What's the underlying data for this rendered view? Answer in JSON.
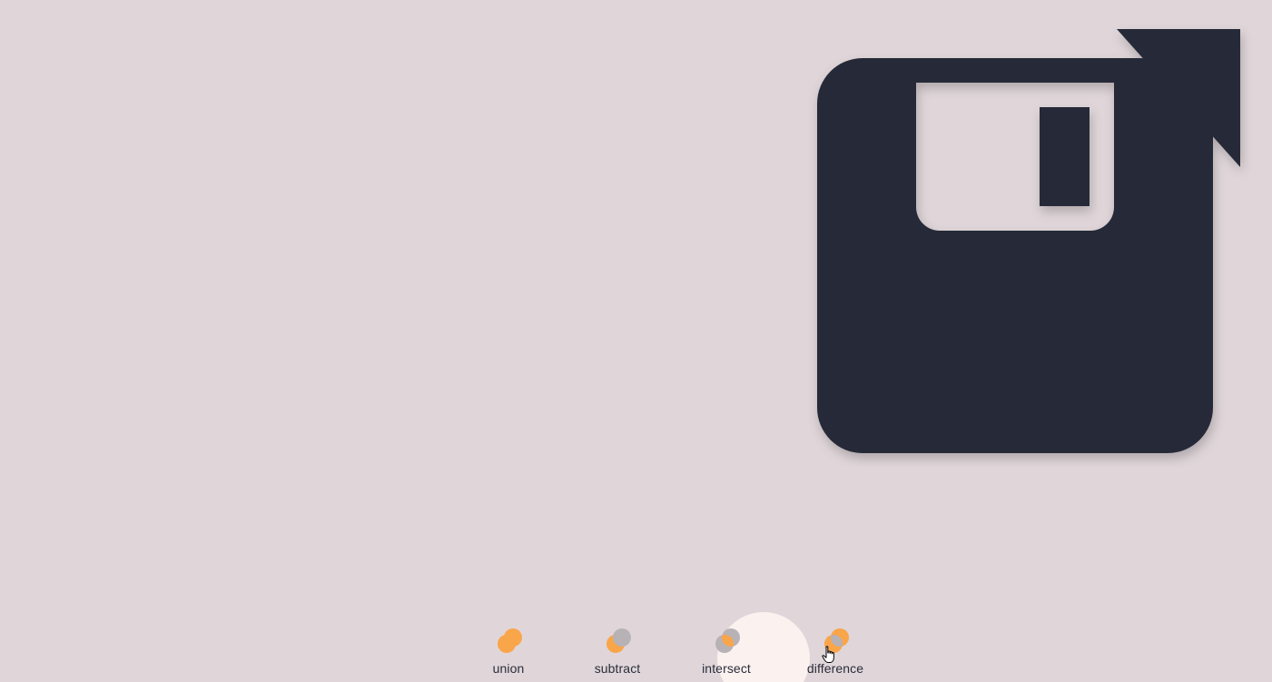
{
  "colors": {
    "background": "#e0d6da",
    "shape_fill": "#282c39",
    "accent": "#f9a54a",
    "neutral_circle": "#b7b2b5",
    "hover": "#fbf1ef",
    "label": "#2a2d39"
  },
  "canvas": {
    "shape_name": "floppy-disk-boolean-result"
  },
  "toolbar": {
    "hovered": "difference",
    "operations": [
      {
        "id": "union",
        "label": "union",
        "icon": "union-icon"
      },
      {
        "id": "subtract",
        "label": "subtract",
        "icon": "subtract-icon"
      },
      {
        "id": "intersect",
        "label": "intersect",
        "icon": "intersect-icon"
      },
      {
        "id": "difference",
        "label": "difference",
        "icon": "difference-icon"
      }
    ]
  },
  "cursor": {
    "type": "pointer-hand-icon"
  }
}
